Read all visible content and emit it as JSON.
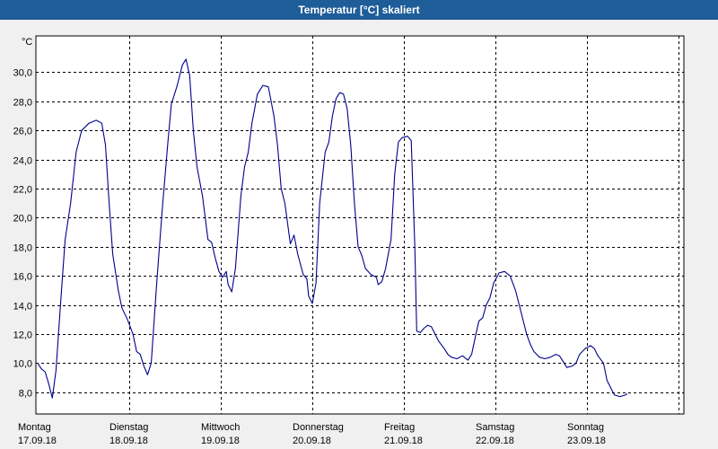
{
  "window": {
    "title": "Temperatur [°C] skaliert"
  },
  "colors": {
    "titlebar": "#1f5d99",
    "line": "#00008b",
    "grid": "#000000",
    "background": "#ffffff"
  },
  "chart_data": {
    "type": "line",
    "title": "Temperatur [°C] skaliert",
    "ylabel": "°C",
    "xlabel": "",
    "ylim": [
      6.5,
      32.5
    ],
    "yticks": [
      8,
      10,
      12,
      14,
      16,
      18,
      20,
      22,
      24,
      26,
      28,
      30
    ],
    "ytick_labels": [
      "8,0",
      "10,0",
      "12,0",
      "14,0",
      "16,0",
      "18,0",
      "20,0",
      "22,0",
      "24,0",
      "26,0",
      "28,0",
      "30,0"
    ],
    "xlim": [
      0,
      7
    ],
    "x_categories": [
      {
        "day": "Montag",
        "date": "17.09.18"
      },
      {
        "day": "Dienstag",
        "date": "18.09.18"
      },
      {
        "day": "Mittwoch",
        "date": "19.09.18"
      },
      {
        "day": "Donnerstag",
        "date": "20.09.18"
      },
      {
        "day": "Freitag",
        "date": "21.09.18"
      },
      {
        "day": "Samstag",
        "date": "22.09.18"
      },
      {
        "day": "Sonntag",
        "date": "23.09.18"
      }
    ],
    "grid": true,
    "series": [
      {
        "color": "#00008b",
        "points": [
          [
            0.0,
            10.0
          ],
          [
            0.04,
            9.6
          ],
          [
            0.08,
            9.4
          ],
          [
            0.12,
            8.6
          ],
          [
            0.16,
            7.6
          ],
          [
            0.2,
            9.5
          ],
          [
            0.26,
            15.0
          ],
          [
            0.3,
            18.5
          ],
          [
            0.36,
            21.0
          ],
          [
            0.42,
            24.5
          ],
          [
            0.48,
            26.0
          ],
          [
            0.56,
            26.5
          ],
          [
            0.64,
            26.7
          ],
          [
            0.7,
            26.5
          ],
          [
            0.74,
            25.0
          ],
          [
            0.78,
            21.0
          ],
          [
            0.82,
            17.5
          ],
          [
            0.88,
            15.0
          ],
          [
            0.92,
            13.8
          ],
          [
            0.98,
            13.0
          ],
          [
            1.04,
            12.0
          ],
          [
            1.08,
            10.8
          ],
          [
            1.12,
            10.6
          ],
          [
            1.16,
            9.8
          ],
          [
            1.2,
            9.2
          ],
          [
            1.24,
            10.0
          ],
          [
            1.3,
            15.5
          ],
          [
            1.36,
            20.5
          ],
          [
            1.42,
            25.0
          ],
          [
            1.46,
            27.8
          ],
          [
            1.52,
            29.0
          ],
          [
            1.58,
            30.5
          ],
          [
            1.62,
            30.9
          ],
          [
            1.66,
            29.8
          ],
          [
            1.7,
            26.0
          ],
          [
            1.74,
            23.5
          ],
          [
            1.8,
            21.5
          ],
          [
            1.86,
            18.5
          ],
          [
            1.9,
            18.3
          ],
          [
            1.94,
            17.2
          ],
          [
            1.98,
            16.3
          ],
          [
            2.02,
            15.9
          ],
          [
            2.06,
            16.3
          ],
          [
            2.08,
            15.4
          ],
          [
            2.12,
            14.9
          ],
          [
            2.16,
            16.5
          ],
          [
            2.22,
            21.5
          ],
          [
            2.26,
            23.5
          ],
          [
            2.3,
            24.5
          ],
          [
            2.34,
            26.5
          ],
          [
            2.4,
            28.5
          ],
          [
            2.46,
            29.1
          ],
          [
            2.52,
            29.0
          ],
          [
            2.58,
            27.0
          ],
          [
            2.62,
            25.0
          ],
          [
            2.66,
            22.0
          ],
          [
            2.7,
            21.0
          ],
          [
            2.76,
            18.2
          ],
          [
            2.8,
            18.8
          ],
          [
            2.84,
            17.5
          ],
          [
            2.9,
            16.1
          ],
          [
            2.94,
            15.8
          ],
          [
            2.96,
            14.6
          ],
          [
            3.0,
            14.1
          ],
          [
            3.04,
            15.5
          ],
          [
            3.08,
            21.0
          ],
          [
            3.14,
            24.5
          ],
          [
            3.18,
            25.2
          ],
          [
            3.22,
            27.0
          ],
          [
            3.26,
            28.2
          ],
          [
            3.3,
            28.6
          ],
          [
            3.34,
            28.5
          ],
          [
            3.38,
            27.5
          ],
          [
            3.42,
            25.0
          ],
          [
            3.46,
            21.0
          ],
          [
            3.5,
            18.0
          ],
          [
            3.54,
            17.4
          ],
          [
            3.58,
            16.5
          ],
          [
            3.64,
            16.1
          ],
          [
            3.7,
            15.9
          ],
          [
            3.72,
            15.4
          ],
          [
            3.76,
            15.6
          ],
          [
            3.8,
            16.5
          ],
          [
            3.86,
            18.5
          ],
          [
            3.9,
            23.0
          ],
          [
            3.94,
            25.2
          ],
          [
            3.98,
            25.5
          ],
          [
            4.04,
            25.6
          ],
          [
            4.08,
            25.3
          ],
          [
            4.12,
            18.0
          ],
          [
            4.14,
            12.2
          ],
          [
            4.18,
            12.1
          ],
          [
            4.22,
            12.4
          ],
          [
            4.26,
            12.6
          ],
          [
            4.3,
            12.5
          ],
          [
            4.34,
            12.0
          ],
          [
            4.38,
            11.5
          ],
          [
            4.44,
            11.0
          ],
          [
            4.48,
            10.6
          ],
          [
            4.52,
            10.4
          ],
          [
            4.58,
            10.3
          ],
          [
            4.64,
            10.5
          ],
          [
            4.7,
            10.2
          ],
          [
            4.74,
            10.6
          ],
          [
            4.78,
            11.8
          ],
          [
            4.82,
            12.9
          ],
          [
            4.86,
            13.1
          ],
          [
            4.9,
            14.0
          ],
          [
            4.94,
            14.5
          ],
          [
            4.98,
            15.5
          ],
          [
            5.04,
            16.2
          ],
          [
            5.1,
            16.3
          ],
          [
            5.16,
            16.0
          ],
          [
            5.22,
            15.0
          ],
          [
            5.28,
            13.5
          ],
          [
            5.34,
            12.0
          ],
          [
            5.38,
            11.3
          ],
          [
            5.42,
            10.8
          ],
          [
            5.48,
            10.4
          ],
          [
            5.54,
            10.3
          ],
          [
            5.6,
            10.4
          ],
          [
            5.66,
            10.6
          ],
          [
            5.7,
            10.5
          ],
          [
            5.74,
            10.1
          ],
          [
            5.78,
            9.7
          ],
          [
            5.84,
            9.8
          ],
          [
            5.88,
            10.0
          ],
          [
            5.92,
            10.6
          ],
          [
            5.98,
            11.0
          ],
          [
            6.04,
            11.2
          ],
          [
            6.08,
            11.0
          ],
          [
            6.12,
            10.5
          ],
          [
            6.18,
            10.0
          ],
          [
            6.22,
            8.8
          ],
          [
            6.26,
            8.3
          ],
          [
            6.3,
            7.8
          ],
          [
            6.36,
            7.7
          ],
          [
            6.42,
            7.8
          ],
          [
            6.44,
            7.9
          ]
        ]
      }
    ]
  }
}
